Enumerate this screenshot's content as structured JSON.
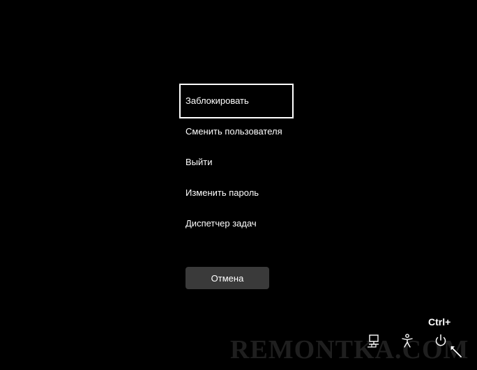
{
  "menu": {
    "items": [
      {
        "label": "Заблокировать",
        "focused": true
      },
      {
        "label": "Сменить пользователя",
        "focused": false
      },
      {
        "label": "Выйти",
        "focused": false
      },
      {
        "label": "Изменить пароль",
        "focused": false
      },
      {
        "label": "Диспетчер задач",
        "focused": false
      }
    ]
  },
  "cancel_button": {
    "label": "Отмена"
  },
  "annotation": {
    "ctrl_label": "Ctrl+"
  },
  "tray": {
    "icons": [
      "network-icon",
      "accessibility-icon",
      "power-icon"
    ]
  },
  "watermark": {
    "text": "REMONTKA.COM"
  },
  "colors": {
    "background": "#000000",
    "text": "#ffffff",
    "button": "#3a3a3a"
  }
}
